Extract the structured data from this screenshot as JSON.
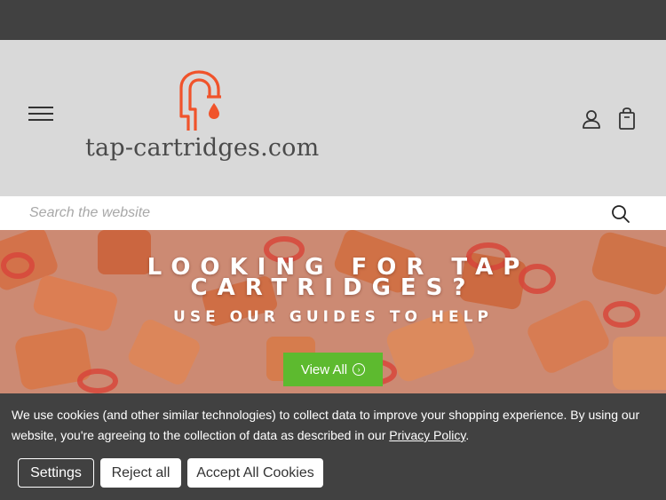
{
  "header": {
    "brand": "tap-cartridges.com"
  },
  "search": {
    "placeholder": "Search the website"
  },
  "hero": {
    "heading_line1": "LOOKING FOR TAP",
    "heading_line2": "CARTRIDGES?",
    "subheading": "USE OUR GUIDES TO HELP",
    "cta_label": "View All"
  },
  "cookie_banner": {
    "text_before_link": "We use cookies (and other similar technologies) to collect data to improve your shopping experience. By using our website, you're agreeing to the collection of data as described in our ",
    "privacy_link": "Privacy Policy",
    "text_after_link": ".",
    "settings_label": "Settings",
    "reject_label": "Reject all",
    "accept_label": "Accept All Cookies"
  },
  "colors": {
    "topbar": "#414141",
    "header_bg": "#d9d9d9",
    "logo_accent": "#f0532b",
    "cta_green": "#5dba2f",
    "cookie_bg": "#414141"
  },
  "icons": {
    "menu": "hamburger-menu-icon",
    "account": "user-account-icon",
    "cart": "shopping-bag-icon",
    "search": "search-icon",
    "cta_arrow": "chevron-right-circle-icon",
    "logo": "tap-faucet-logo-icon"
  }
}
